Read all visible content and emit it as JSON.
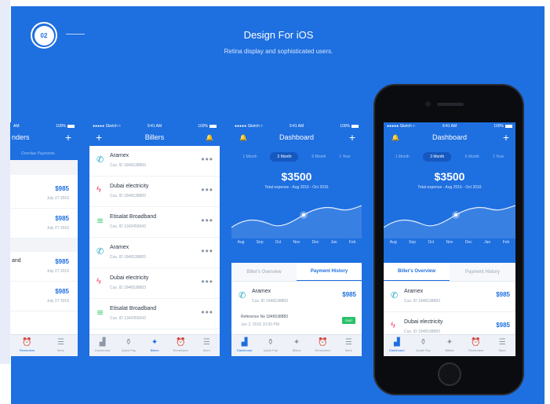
{
  "header": {
    "badge": "02",
    "title": "Design For iOS",
    "subtitle": "Retina display and sophisticated users."
  },
  "status": {
    "carrier": "●●●●● Sketch ≈",
    "time": "9:41 AM",
    "battery": "100%"
  },
  "screen_left": {
    "status_time": "AM",
    "status_battery": "100%",
    "title_partial": "nders",
    "sub_label": "Overdue Payments",
    "items": [
      {
        "name": "",
        "amount": "$985",
        "date": "July 27 2016"
      },
      {
        "name": "",
        "amount": "$985",
        "date": "July 27 2016"
      },
      {
        "name": "and",
        "amount": "$985",
        "date": "July 27 2016"
      },
      {
        "name": "",
        "amount": "$985",
        "date": "July 27 2016"
      }
    ]
  },
  "billers": {
    "title": "Billers",
    "items": [
      {
        "name": "Aramex",
        "id": "Cus. ID 1846538883",
        "icon": "phone-icon",
        "color": "#1fa7c4"
      },
      {
        "name": "Dubai electricity",
        "id": "Cus. ID 1846538883",
        "icon": "lightning-icon",
        "color": "#f2456e"
      },
      {
        "name": "Etisalat Broadband",
        "id": "Cus. ID 1342455643",
        "icon": "wifi-icon",
        "color": "#3ccf6b"
      },
      {
        "name": "Aramex",
        "id": "Cus. ID 1846538883",
        "icon": "phone-icon",
        "color": "#1fa7c4"
      },
      {
        "name": "Dubai electricity",
        "id": "Cus. ID 1846538883",
        "icon": "lightning-icon",
        "color": "#f2456e"
      },
      {
        "name": "Etisalat Broadband",
        "id": "Cus. ID 1342455643",
        "icon": "wifi-icon",
        "color": "#3ccf6b"
      }
    ]
  },
  "dashboard": {
    "title": "Dashboard",
    "periods": [
      "1 Month",
      "3 Month",
      "6 Month",
      "1 Year"
    ],
    "selected_period": "3 Month",
    "amount": "$3500",
    "range": "Total expense - Aug 2016 - Oct 2016",
    "months": [
      "Aug",
      "Sep",
      "Oct",
      "Nov",
      "Dec",
      "Jan",
      "Feb"
    ],
    "segments": [
      "Biller's Overview",
      "Payment History"
    ],
    "history": {
      "name": "Aramex",
      "id": "Cus. ID 1846538883",
      "amount": "$985",
      "reference": "Reference No 1846538883",
      "date": "Jun 2, 2016 10:00 PM",
      "status": "PAID"
    },
    "phone_items": [
      {
        "name": "Aramex",
        "id": "Cus. ID 1846538883",
        "amount": "$985"
      },
      {
        "name": "Dubai electricity",
        "id": "Cus. ID 1846538883",
        "amount": "$985"
      }
    ]
  },
  "tabbar": [
    "Dashboard",
    "Quick Pay",
    "Billers",
    "Reminders",
    "More"
  ],
  "left_tabbar": [
    "Reminders",
    "More"
  ]
}
